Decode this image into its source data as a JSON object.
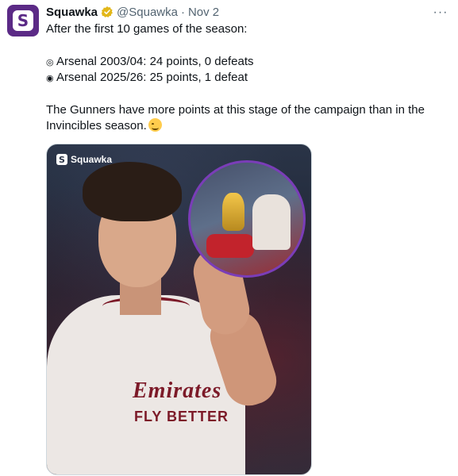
{
  "tweet": {
    "display_name": "Squawka",
    "handle": "@Squawka",
    "separator": "·",
    "date": "Nov 2",
    "more_label": "···",
    "avatar_letter": "S",
    "lines": {
      "l1": "After the first 10 games of the season:",
      "l2": "Arsenal 2003/04: 24 points, 0 defeats",
      "l3": "Arsenal 2025/26: 25 points, 1 defeat",
      "l4": "The Gunners have more points at this stage of the campaign than in the Invincibles season."
    },
    "bullets": {
      "b1": "◎",
      "b2": "◉"
    }
  },
  "media": {
    "watermark": "Squawka",
    "watermark_letter": "S",
    "shirt_text": "Emirates",
    "shirt_sub": "FLY BETTER"
  },
  "colors": {
    "brand": "#5b2a86",
    "verified": "#e2b719",
    "text": "#0f1419",
    "muted": "#536471",
    "inset_border": "#7a3db8"
  }
}
